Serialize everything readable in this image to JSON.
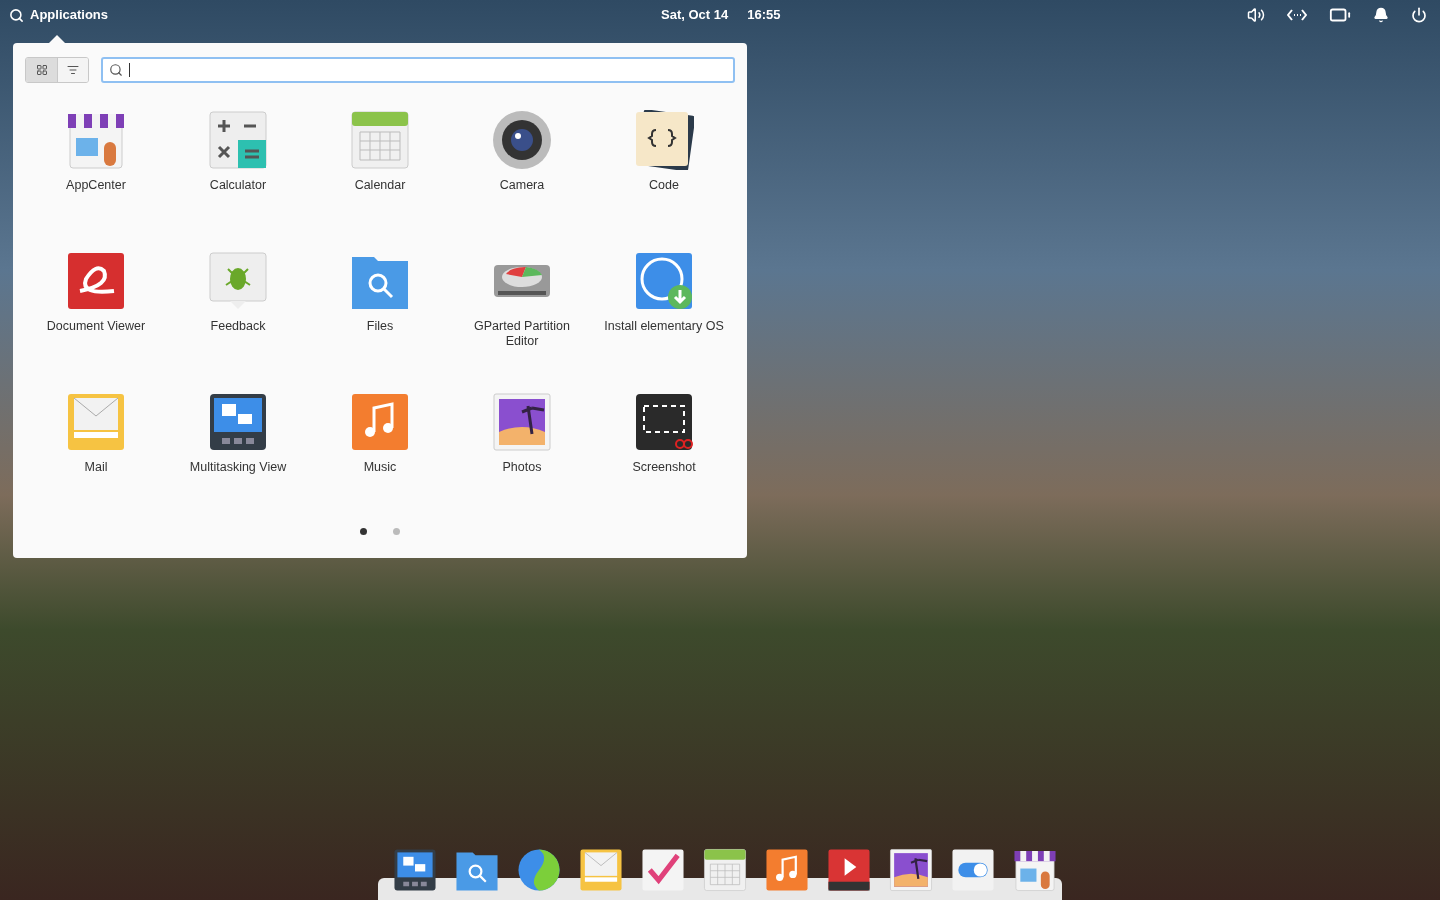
{
  "top_bar": {
    "launcher_label": "Applications",
    "date": "Sat, Oct 14",
    "time": "16:55"
  },
  "launcher": {
    "view_modes": [
      {
        "selected": true
      },
      {
        "selected": false
      }
    ],
    "apps": [
      {
        "name": "AppCenter"
      },
      {
        "name": "Calculator"
      },
      {
        "name": "Calendar"
      },
      {
        "name": "Camera"
      },
      {
        "name": "Code"
      },
      {
        "name": "Document Viewer"
      },
      {
        "name": "Feedback"
      },
      {
        "name": "Files"
      },
      {
        "name": "GParted Partition Editor"
      },
      {
        "name": "Install elementary OS"
      },
      {
        "name": "Mail"
      },
      {
        "name": "Multitasking View"
      },
      {
        "name": "Music"
      },
      {
        "name": "Photos"
      },
      {
        "name": "Screenshot"
      }
    ],
    "pages": [
      {
        "selected": true
      },
      {
        "selected": false
      }
    ]
  }
}
